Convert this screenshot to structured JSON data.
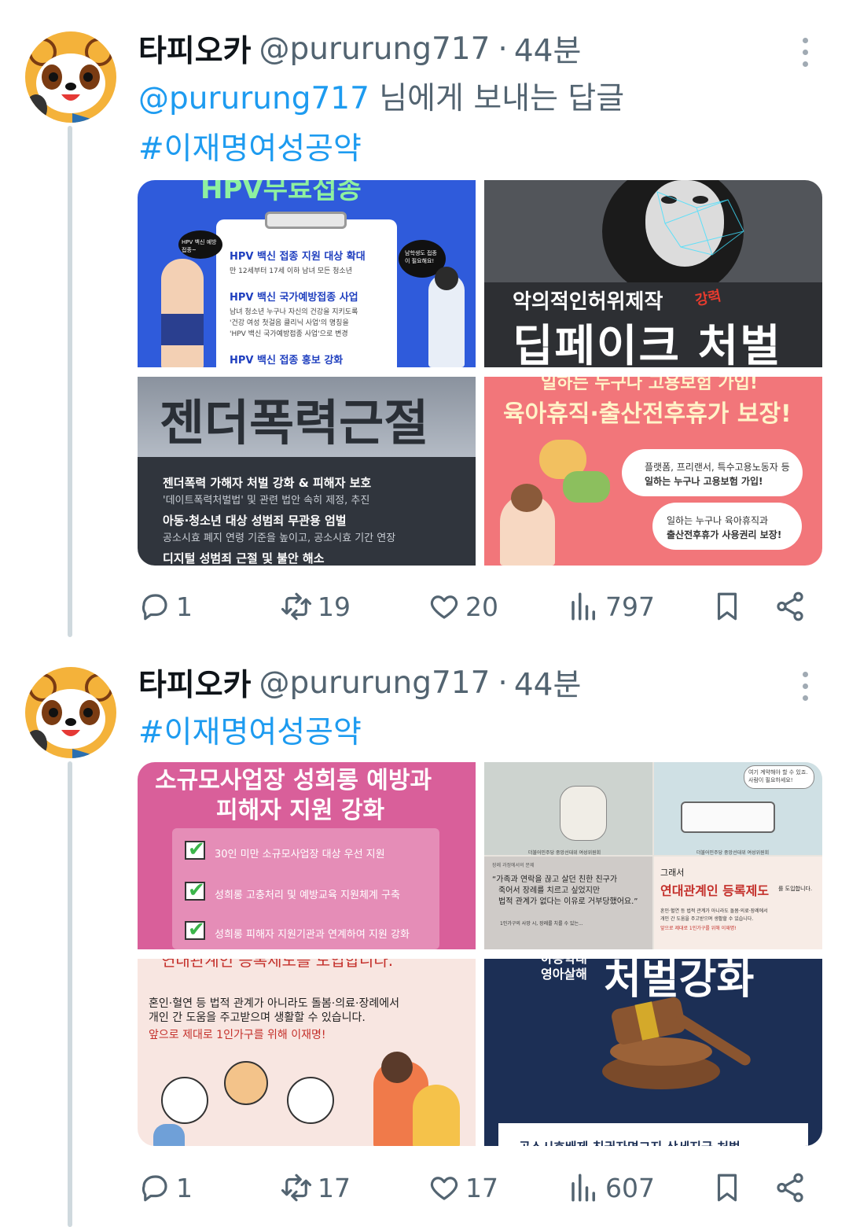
{
  "tweets": [
    {
      "author": {
        "name": "타피오카",
        "handle": "@pururung717",
        "time": "44분"
      },
      "reply_mention": "@pururung717",
      "reply_suffix": "님에게 보내는 답글",
      "hashtag": "#이재명여성공약",
      "media": [
        {
          "title_top": "HPV무료접종",
          "bubble_left": "HPV 백신 예방접종~",
          "bubble_right": "남학생도 접종이 필요해요!",
          "h1": "HPV 백신 접종 지원 대상 확대",
          "p1": "만 12세부터 17세 이하 남녀 모든 청소년",
          "h2": "HPV 백신 국가예방접종 사업",
          "p2a": "남녀 청소년 누구나 자신의 건강을 지키도록",
          "p2b": "'건강 여성 첫걸음 클리닉 사업'의 명칭을",
          "p2c": "'HPV 백신 국가예방접종 사업'으로 변경",
          "h3": "HPV 백신 접종 홍보 강화"
        },
        {
          "line1": "악의적인허위제작",
          "stamp": "강력",
          "line2": "딥페이크 처벌"
        },
        {
          "title": "젠더폭력근절",
          "h1": "젠더폭력 가해자 처벌 강화 & 피해자 보호",
          "p1": "'데이트폭력처벌법' 및 관련 법안 속히 제정, 추진",
          "h2": "아동·청소년 대상 성범죄 무관용 엄벌",
          "p2": "공소시효 폐지 연령 기준을 높이고, 공소시효 기간 연장",
          "h3": "디지털 성범죄 근절 및 불안 해소"
        },
        {
          "top": "일하는 누구나 고용보험 가입!",
          "title": "육아휴직·출산전후휴가 보장!",
          "b1a": "플랫폼, 프리랜서, 특수고용노동자 등",
          "b1b": "일하는 누구나 고용보험 가입!",
          "b2a": "일하는 누구나 육아휴직과",
          "b2b": "출산전후휴가 사용권리 보장!"
        }
      ],
      "stats": {
        "replies": "1",
        "reposts": "19",
        "likes": "20",
        "views": "797"
      }
    },
    {
      "author": {
        "name": "타피오카",
        "handle": "@pururung717",
        "time": "44분"
      },
      "hashtag": "#이재명여성공약",
      "media": [
        {
          "title1": "소규모사업장 성희롱 예방과",
          "title2": "피해자 지원 강화",
          "items": [
            "30인 미만 소규모사업장 대상 우선 지원",
            "성희롱 고충처리 및 예방교육 지원체계 구축",
            "성희롱 피해자 지원기관과 연계하여 지원 강화"
          ]
        },
        {
          "caption1": "더불어민주당 중앙선대위 여성위원회",
          "caption2": "더불어민주당 중앙선대위 여성위원회",
          "bubble": "여기 계약해야 할 수 있죠. 사람이 필요하세요!",
          "src": "장례 과정에서의 문제",
          "quote1": "“가족과 연락을 끊고 살던 친한 친구가",
          "quote2": "죽어서 장례를 치르고 싶었지만",
          "quote3": "법적 관계가 없다는 이유로 거부당했어요.”",
          "note": "1인가구의 사망 시, 장례를 치를 수 있는...",
          "then": "그래서",
          "system": "연대관계인 등록제도",
          "system_suffix": "를 도입합니다.",
          "desc1": "혼인·혈연 등 법적 관계가 아니라도 돌봄·의료·장례에서",
          "desc2": "개인 간 도움을 주고받으며 생활할 수 있습니다.",
          "desc3": "앞으로 제대로 1인가구를 위해 이재명!"
        },
        {
          "top": "연대관계인 등록제도를 도입합니다.",
          "p1": "혼인·혈연 등 법적 관계가 아니라도 돌봄·의료·장례에서",
          "p2": "개인 간 도움을 주고받으며 생활할 수 있습니다.",
          "p3": "앞으로 제대로 1인가구를 위해 이재명!"
        },
        {
          "small1": "아동학대",
          "small2": "영아살해",
          "big": "처벌강화",
          "bottom": "공소시효배제   친권자면그지   상세지금 처벌"
        }
      ],
      "stats": {
        "replies": "1",
        "reposts": "17",
        "likes": "17",
        "views": "607"
      }
    }
  ]
}
